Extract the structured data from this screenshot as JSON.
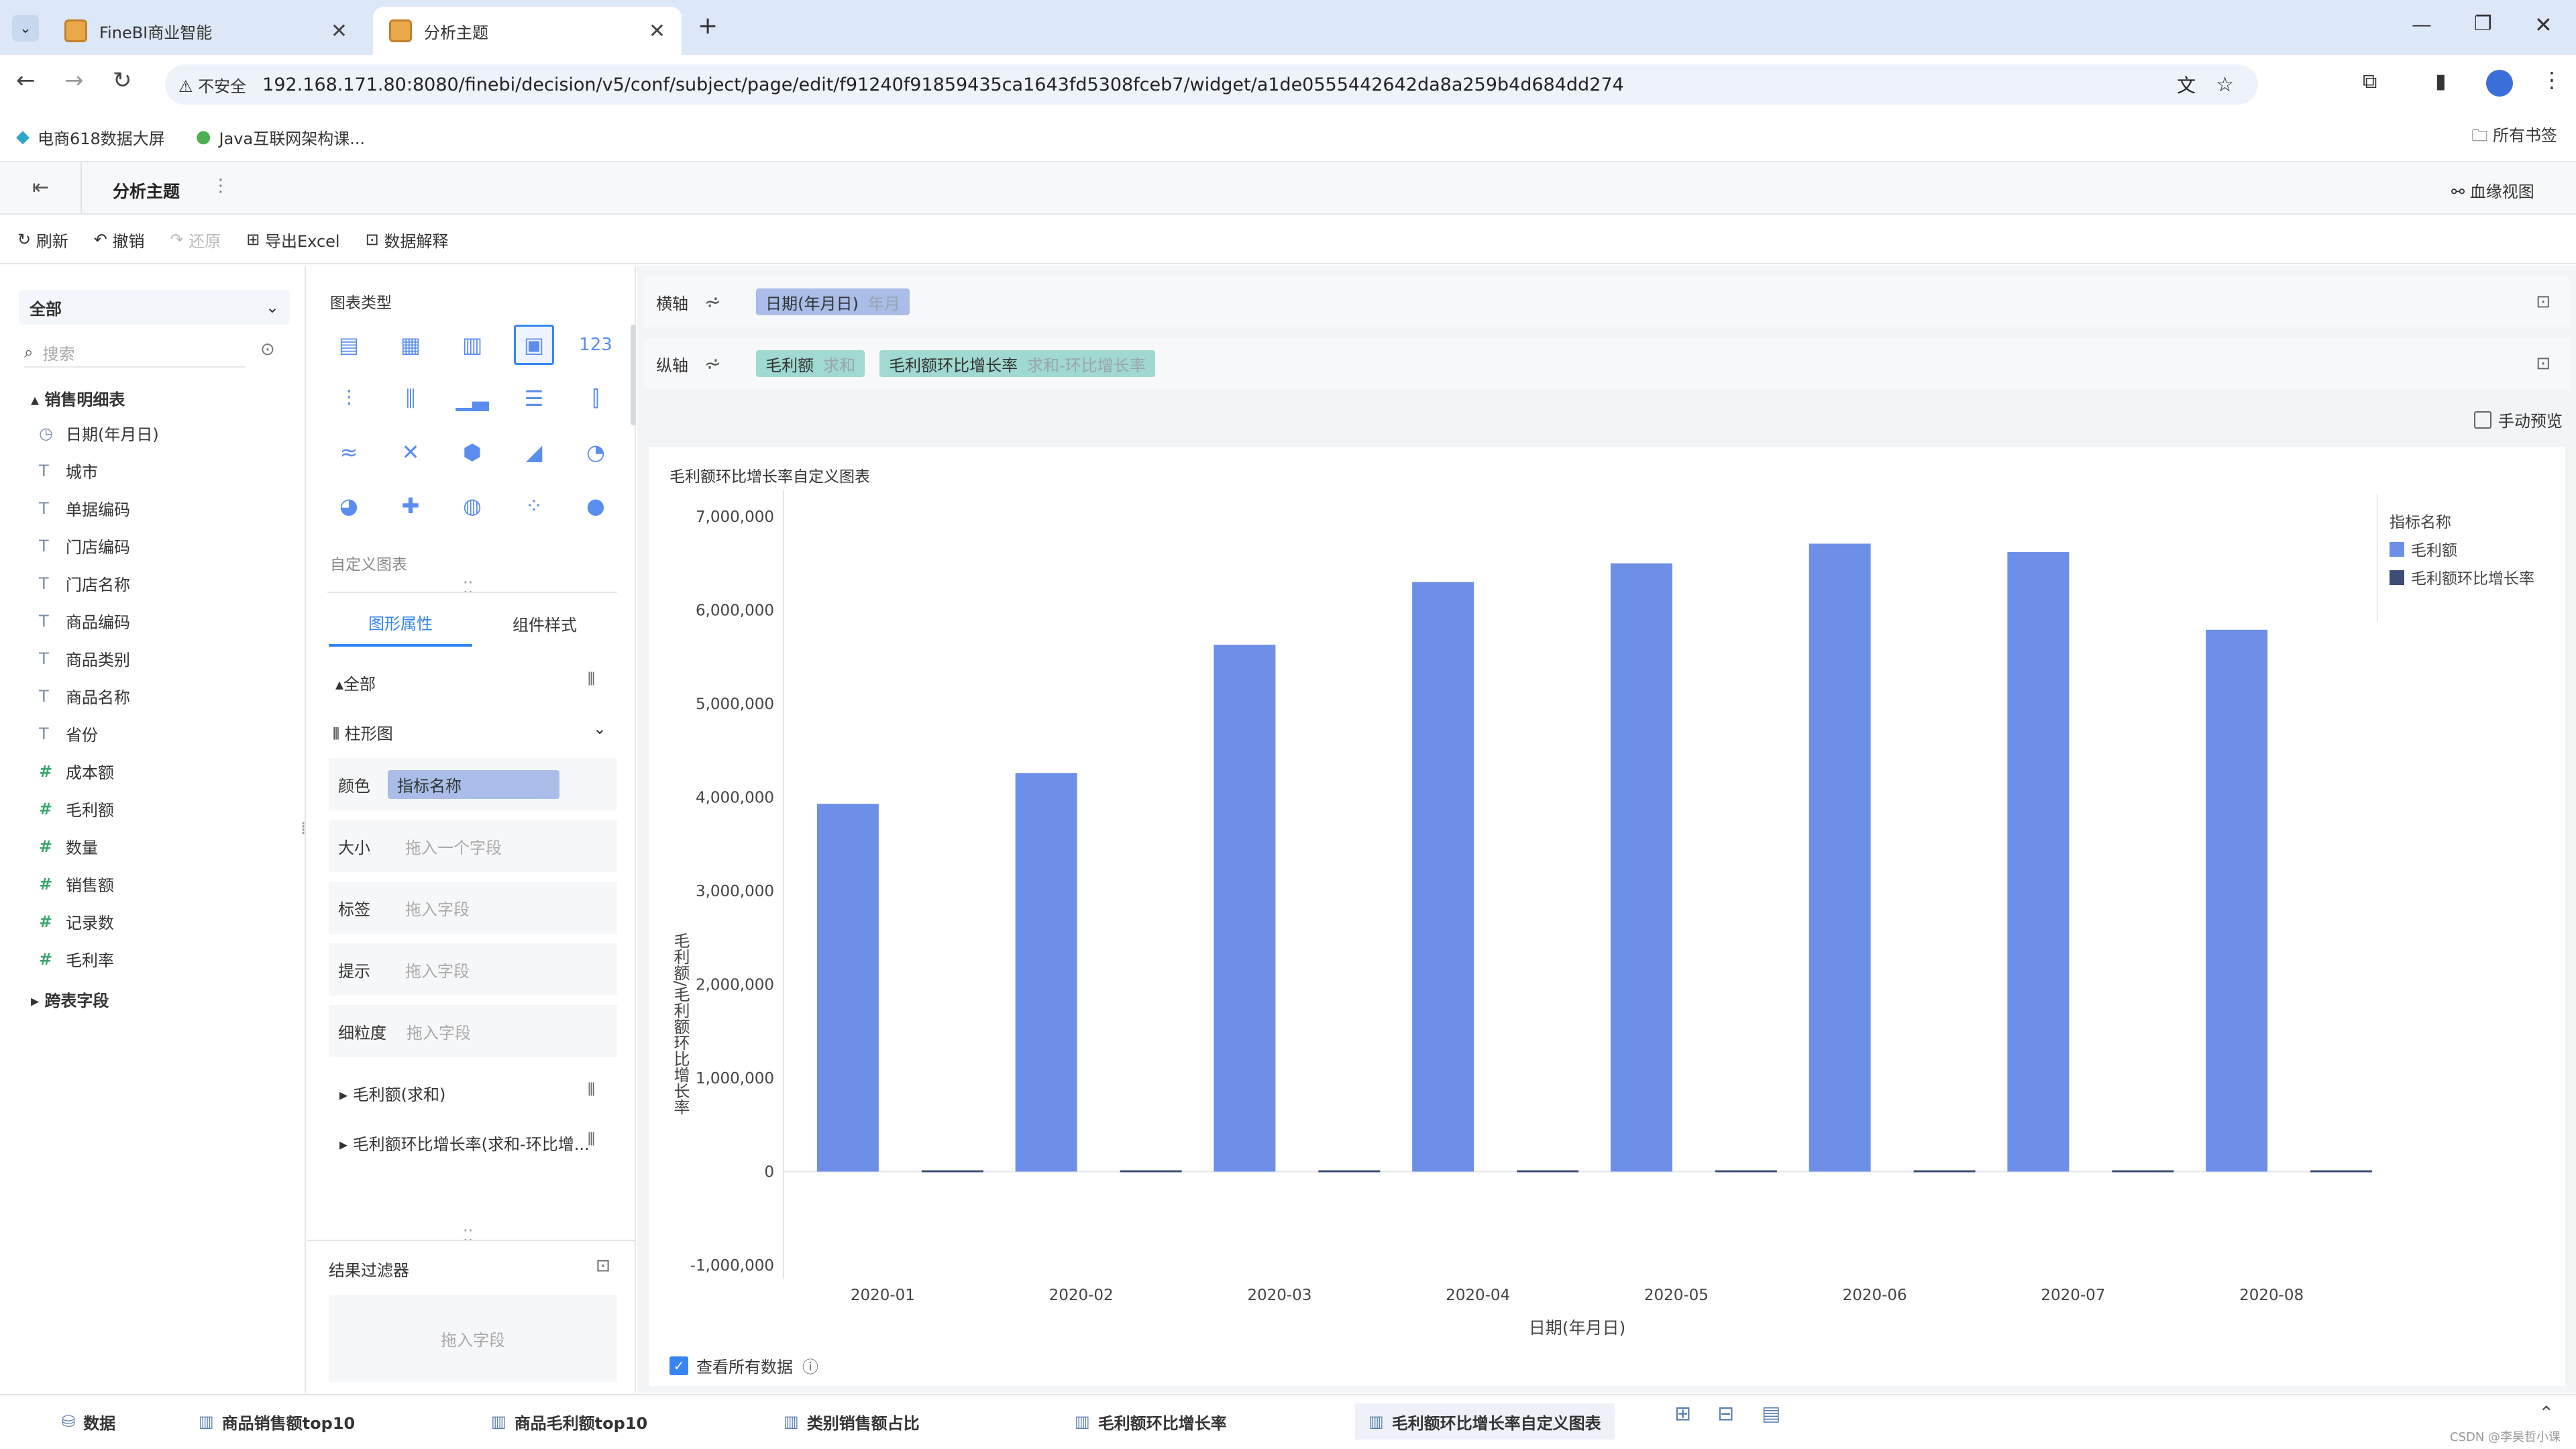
{
  "browser": {
    "tabs": [
      {
        "label": "FineBI商业智能"
      },
      {
        "label": "分析主题"
      }
    ],
    "security_label": "不安全",
    "url": "192.168.171.80:8080/finebi/decision/v5/conf/subject/page/edit/f91240f91859435ca1643fd5308fceb7/widget/a1de0555442642da8a259b4d684dd274",
    "bookmarks": [
      "电商618数据大屏",
      "Java互联网架构课..."
    ],
    "all_bookmarks": "所有书签"
  },
  "app": {
    "title": "分析主题",
    "lineage": "血缘视图",
    "toolbar": {
      "refresh": "刷新",
      "undo": "撤销",
      "redo": "还原",
      "export": "导出Excel",
      "explain": "数据解释"
    }
  },
  "fields": {
    "scope": "全部",
    "search_placeholder": "搜索",
    "table_name": "销售明细表",
    "items": [
      {
        "icon": "time",
        "label": "日期(年月日)"
      },
      {
        "icon": "text",
        "label": "城市"
      },
      {
        "icon": "text",
        "label": "单据编码"
      },
      {
        "icon": "text",
        "label": "门店编码"
      },
      {
        "icon": "text",
        "label": "门店名称"
      },
      {
        "icon": "text",
        "label": "商品编码"
      },
      {
        "icon": "text",
        "label": "商品类别"
      },
      {
        "icon": "text",
        "label": "商品名称"
      },
      {
        "icon": "text",
        "label": "省份"
      },
      {
        "icon": "num",
        "label": "成本额"
      },
      {
        "icon": "num",
        "label": "毛利额"
      },
      {
        "icon": "num",
        "label": "数量"
      },
      {
        "icon": "num",
        "label": "销售额"
      },
      {
        "icon": "num",
        "label": "记录数"
      },
      {
        "icon": "num",
        "label": "毛利率"
      }
    ],
    "cross_table": "跨表字段"
  },
  "chart_config": {
    "type_title": "图表类型",
    "custom_label": "自定义图表",
    "tab_props": "图形属性",
    "tab_style": "组件样式",
    "all_label": "全部",
    "chart_kind": "柱形图",
    "rows": [
      {
        "label": "颜色",
        "value": "指标名称"
      },
      {
        "label": "大小",
        "placeholder": "拖入一个字段"
      },
      {
        "label": "标签",
        "placeholder": "拖入字段"
      },
      {
        "label": "提示",
        "placeholder": "拖入字段"
      },
      {
        "label": "细粒度",
        "placeholder": "拖入字段"
      }
    ],
    "measures": [
      "毛利额(求和)",
      "毛利额环比增长率(求和-环比增..."
    ],
    "filter_title": "结果过滤器",
    "filter_placeholder": "拖入字段"
  },
  "axes": {
    "x_label": "横轴",
    "x_field": "日期(年月日)",
    "x_sub": "年月",
    "y_label": "纵轴",
    "y_fields": [
      {
        "name": "毛利额",
        "sub": "求和"
      },
      {
        "name": "毛利额环比增长率",
        "sub": "求和-环比增长率"
      }
    ],
    "manual_preview": "手动预览"
  },
  "view_all": "查看所有数据",
  "bottom_tabs": [
    "数据",
    "商品销售额top10",
    "商品毛利额top10",
    "类别销售额占比",
    "毛利额环比增长率",
    "毛利额环比增长率自定义图表"
  ],
  "watermark": "CSDN @李昊哲小课",
  "colors": {
    "bar": "#6d8fe8",
    "bar2": "#3d4e74",
    "accent": "#3685f2"
  },
  "chart_data": {
    "type": "bar",
    "title": "毛利额环比增长率自定义图表",
    "xlabel": "日期(年月日)",
    "ylabel": "毛利额/毛利额环比增长率",
    "categories": [
      "2020-01",
      "2020-02",
      "2020-03",
      "2020-04",
      "2020-05",
      "2020-06",
      "2020-07",
      "2020-08"
    ],
    "series": [
      {
        "name": "毛利额",
        "values": [
          3930000,
          4260000,
          5630000,
          6300000,
          6500000,
          6710000,
          6620000,
          5790000
        ]
      },
      {
        "name": "毛利额环比增长率",
        "values": [
          0,
          0.08,
          0.32,
          0.12,
          0.03,
          0.03,
          -0.01,
          -0.13
        ]
      }
    ],
    "ylim": [
      -1000000,
      7000000
    ],
    "yticks": [
      "7,000,000",
      "6,000,000",
      "5,000,000",
      "4,000,000",
      "3,000,000",
      "2,000,000",
      "1,000,000",
      "0",
      "-1,000,000"
    ],
    "legend_title": "指标名称",
    "legend": "top-right",
    "grid": false
  }
}
